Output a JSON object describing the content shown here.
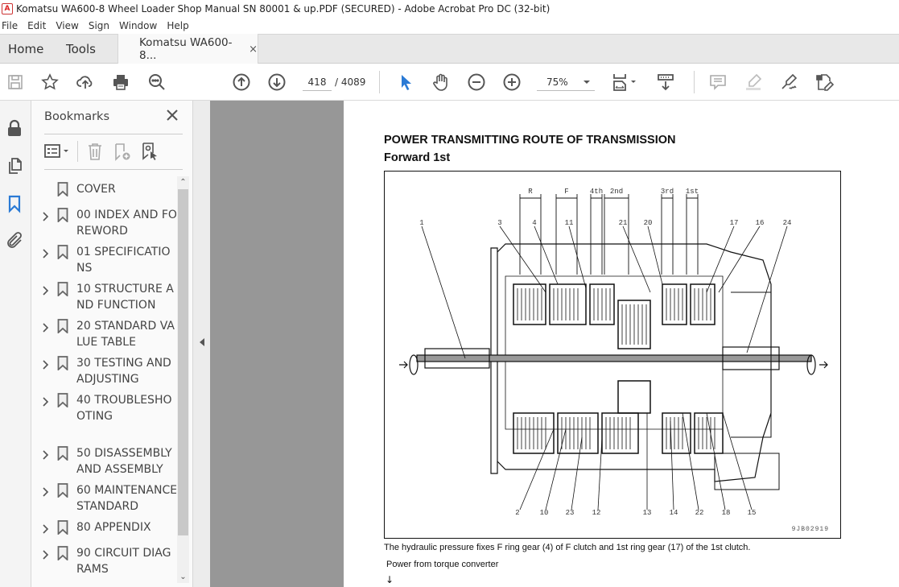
{
  "window": {
    "title": "Komatsu WA600-8 Wheel Loader Shop Manual SN 80001 & up.PDF (SECURED) - Adobe Acrobat Pro DC (32-bit)"
  },
  "menu": [
    "File",
    "Edit",
    "View",
    "Sign",
    "Window",
    "Help"
  ],
  "tabs": {
    "home": "Home",
    "tools": "Tools",
    "document": "Komatsu WA600-8...",
    "document_close": "×"
  },
  "toolbar": {
    "current_page": "418",
    "total_pages": "/ 4089",
    "zoom": "75%",
    "icons": [
      "save-icon",
      "bookmark-star-icon",
      "upload-cloud-icon",
      "print-icon",
      "find-icon",
      "page-up-icon",
      "page-down-icon",
      "select-pointer-icon",
      "hand-icon",
      "zoom-out-icon",
      "zoom-in-icon",
      "fit-page-icon",
      "scroll-mode-icon",
      "comment-icon",
      "highlight-icon",
      "sign-icon",
      "edit-pdf-icon"
    ],
    "accent_color": "#2a7ad5"
  },
  "left_rail": {
    "icons": [
      "lock-icon",
      "pages-icon",
      "bookmarks-icon",
      "attachment-icon"
    ],
    "active": "bookmarks-icon"
  },
  "bookmarks": {
    "title": "Bookmarks",
    "close": "×",
    "items": [
      {
        "label": "COVER",
        "expandable": false
      },
      {
        "label": "00 INDEX AND FOREWORD",
        "expandable": true
      },
      {
        "label": "01 SPECIFICATIONS",
        "expandable": true
      },
      {
        "label": "10 STRUCTURE AND FUNCTION",
        "expandable": true
      },
      {
        "label": "20 STANDARD VALUE TABLE",
        "expandable": true
      },
      {
        "label": "30 TESTING AND ADJUSTING",
        "expandable": true
      },
      {
        "label": "40 TROUBLESHOOTING",
        "expandable": true
      },
      {
        "label": "50 DISASSEMBLY AND ASSEMBLY",
        "expandable": true
      },
      {
        "label": "60 MAINTENANCE STANDARD",
        "expandable": true
      },
      {
        "label": "80 APPENDIX",
        "expandable": true
      },
      {
        "label": "90 CIRCUIT DIAGRAMS",
        "expandable": true
      }
    ]
  },
  "page": {
    "title": "POWER TRANSMITTING ROUTE OF TRANSMISSION",
    "subtitle": "Forward 1st",
    "figure_id": "9JB02919",
    "clutch_labels": [
      "R",
      "F",
      "4th",
      "2nd",
      "3rd",
      "1st"
    ],
    "top_callouts": [
      "1",
      "3",
      "4",
      "11",
      "21",
      "20",
      "17",
      "16",
      "24"
    ],
    "bottom_callouts": [
      "2",
      "10",
      "23",
      "12",
      "13",
      "14",
      "22",
      "18",
      "15"
    ],
    "caption": "The hydraulic pressure fixes F ring gear (4) of F clutch and 1st ring gear (17) of the 1st clutch.",
    "power_from": "Power from torque converter",
    "arrow": "↓"
  }
}
